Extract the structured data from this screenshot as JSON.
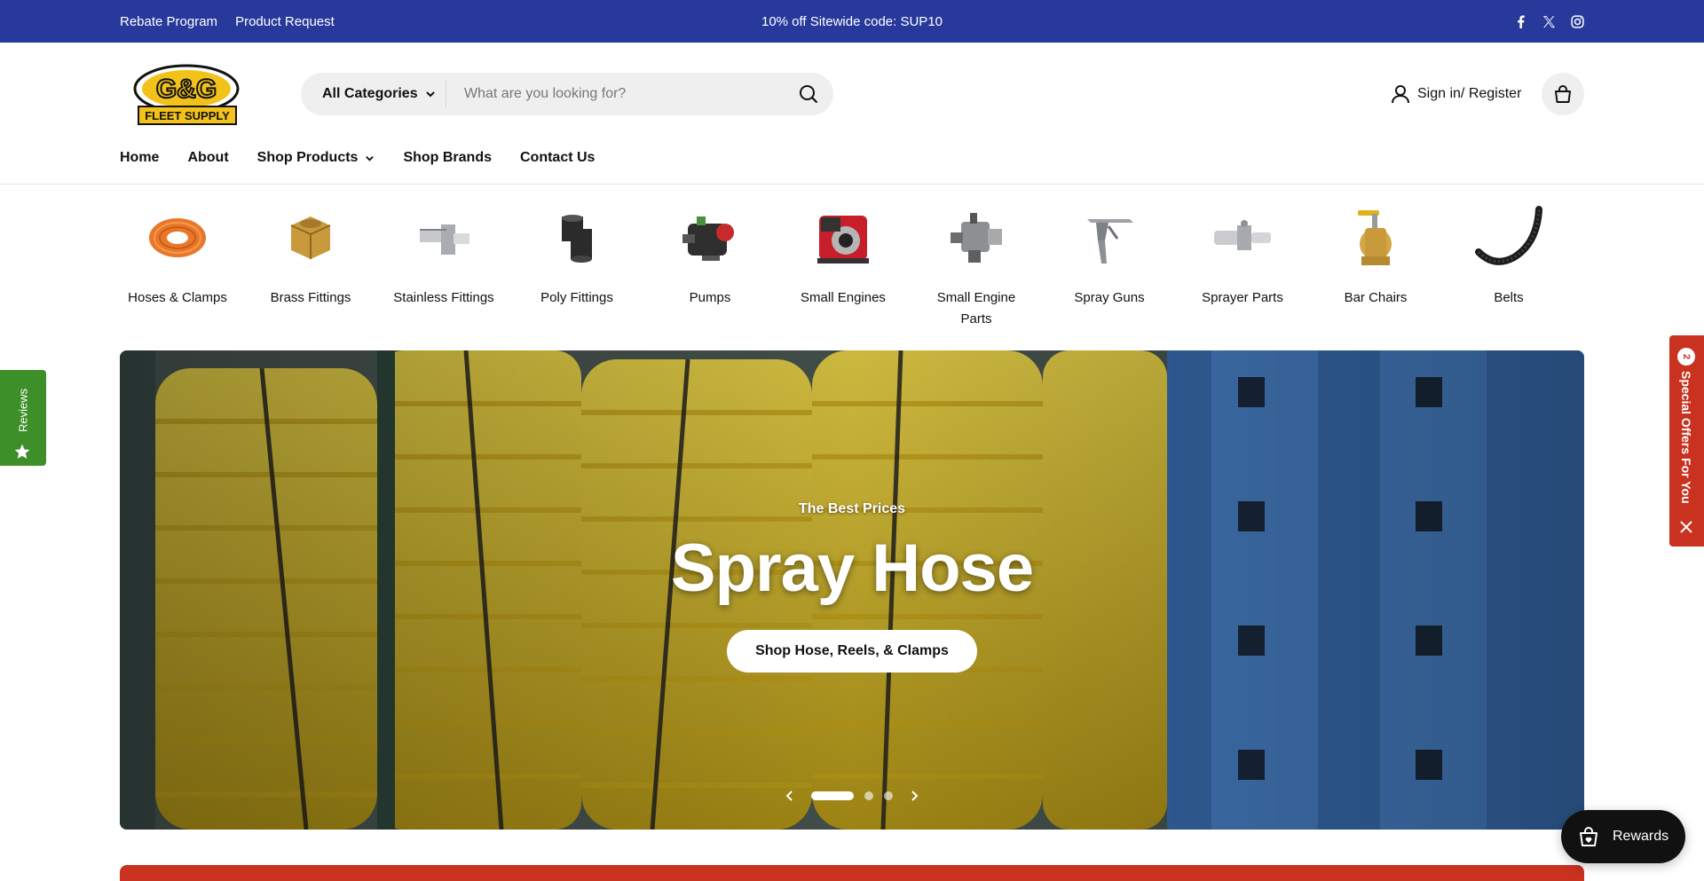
{
  "topbar": {
    "links": [
      "Rebate Program",
      "Product Request"
    ],
    "promo": "10% off Sitewide code: SUP10",
    "social_icons": [
      "facebook-icon",
      "x-icon",
      "instagram-icon"
    ],
    "bg_color": "#27399b"
  },
  "header": {
    "logo_text_top": "G&G",
    "logo_text_bottom": "FLEET SUPPLY",
    "search": {
      "category": "All Categories",
      "placeholder": "What are you looking for?"
    },
    "account_label": "Sign in/ Register"
  },
  "nav": {
    "items": [
      {
        "label": "Home"
      },
      {
        "label": "About"
      },
      {
        "label": "Shop Products",
        "has_dropdown": true
      },
      {
        "label": "Shop Brands"
      },
      {
        "label": "Contact Us"
      }
    ]
  },
  "categories": [
    {
      "label": "Hoses & Clamps",
      "icon": "hose-icon"
    },
    {
      "label": "Brass Fittings",
      "icon": "brass-fitting-icon"
    },
    {
      "label": "Stainless Fittings",
      "icon": "stainless-fitting-icon"
    },
    {
      "label": "Poly Fittings",
      "icon": "poly-fitting-icon"
    },
    {
      "label": "Pumps",
      "icon": "pump-icon"
    },
    {
      "label": "Small Engines",
      "icon": "engine-icon"
    },
    {
      "label": "Small Engine Parts",
      "icon": "carburetor-icon"
    },
    {
      "label": "Spray Guns",
      "icon": "spray-gun-icon"
    },
    {
      "label": "Sprayer Parts",
      "icon": "sprayer-part-icon"
    },
    {
      "label": "Bar Chairs",
      "icon": "ball-valve-icon"
    },
    {
      "label": "Belts",
      "icon": "belt-icon"
    }
  ],
  "hero": {
    "subtitle": "The Best Prices",
    "title": "Spray Hose",
    "button": "Shop Hose, Reels, & Clamps",
    "slides_total": 3,
    "active_slide": 1
  },
  "widgets": {
    "reviews_label": "Reviews",
    "offers_label": "Special Offers For You",
    "offers_count": "2",
    "rewards_label": "Rewards"
  },
  "colors": {
    "accent_red": "#c8321f",
    "reviews_green": "#3d8f2a"
  }
}
